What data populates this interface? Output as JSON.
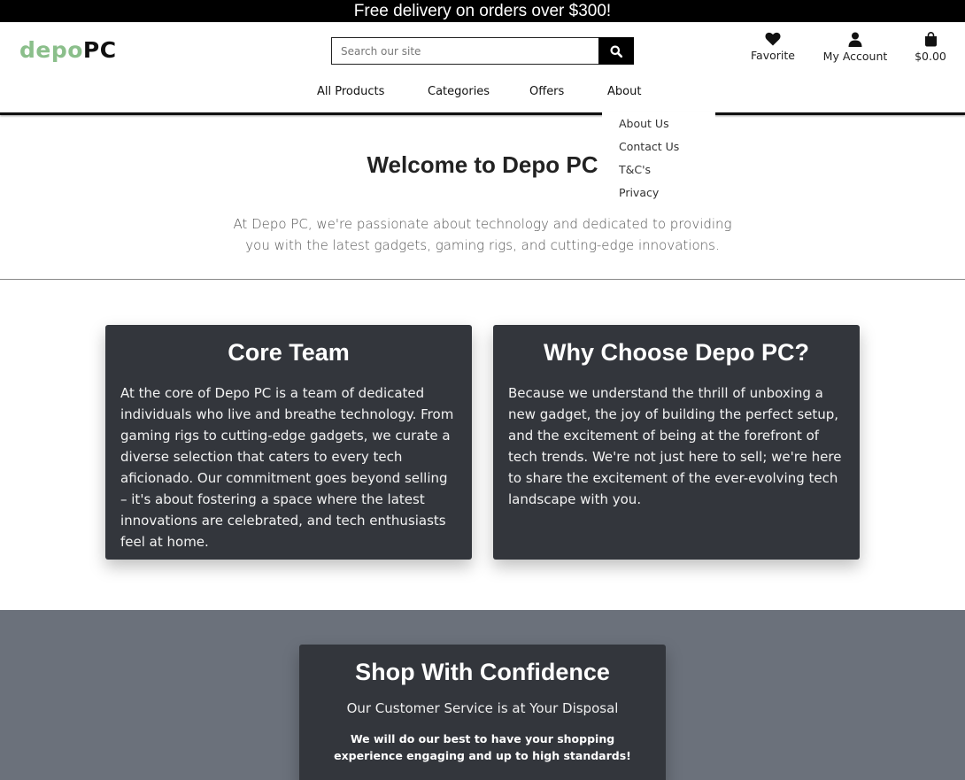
{
  "promo": {
    "text": "Free delivery on orders over $300!"
  },
  "brand": {
    "part1": "depo",
    "part2": "PC",
    "color_part1": "#8bbf8b",
    "color_part2": "#111111"
  },
  "search": {
    "placeholder": "Search our site",
    "button_icon": "search-icon"
  },
  "header_icons": {
    "favorite": {
      "label": "Favorite",
      "icon": "heart-icon"
    },
    "account": {
      "label": "My Account",
      "icon": "user-icon"
    },
    "cart": {
      "label": "$0.00",
      "icon": "shopping-bag-icon"
    }
  },
  "nav": {
    "items": [
      {
        "label": "All Products"
      },
      {
        "label": "Categories"
      },
      {
        "label": "Offers"
      },
      {
        "label": "About"
      }
    ],
    "about_dropdown": [
      {
        "label": "About Us"
      },
      {
        "label": "Contact Us"
      },
      {
        "label": "T&C's"
      },
      {
        "label": "Privacy"
      }
    ]
  },
  "welcome": {
    "title": "Welcome to Depo PC",
    "text": "At Depo PC, we're passionate about technology and dedicated to providing you with the latest gadgets, gaming rigs, and cutting-edge innovations."
  },
  "cards": {
    "core_team": {
      "title": "Core Team",
      "text": "At the core of Depo PC is a team of dedicated individuals who live and breathe technology. From gaming rigs to cutting-edge gadgets, we curate a diverse selection that caters to every tech aficionado. Our commitment goes beyond selling – it's about fostering a space where the latest innovations are celebrated, and tech enthusiasts feel at home."
    },
    "why_choose": {
      "title": "Why Choose Depo PC?",
      "text": "Because we understand the thrill of unboxing a new gadget, the joy of building the perfect setup, and the excitement of being at the forefront of tech trends. We're not just here to sell; we're here to share the excitement of the ever-evolving tech landscape with you."
    }
  },
  "confidence": {
    "title": "Shop With Confidence",
    "subtitle": "Our Customer Service is at Your Disposal",
    "text": "We will do our best to have your shopping experience engaging and up to high standards!"
  },
  "colors": {
    "card_bg": "#33363c",
    "confidence_bg": "#6b717b",
    "promo_bg": "#000000"
  }
}
